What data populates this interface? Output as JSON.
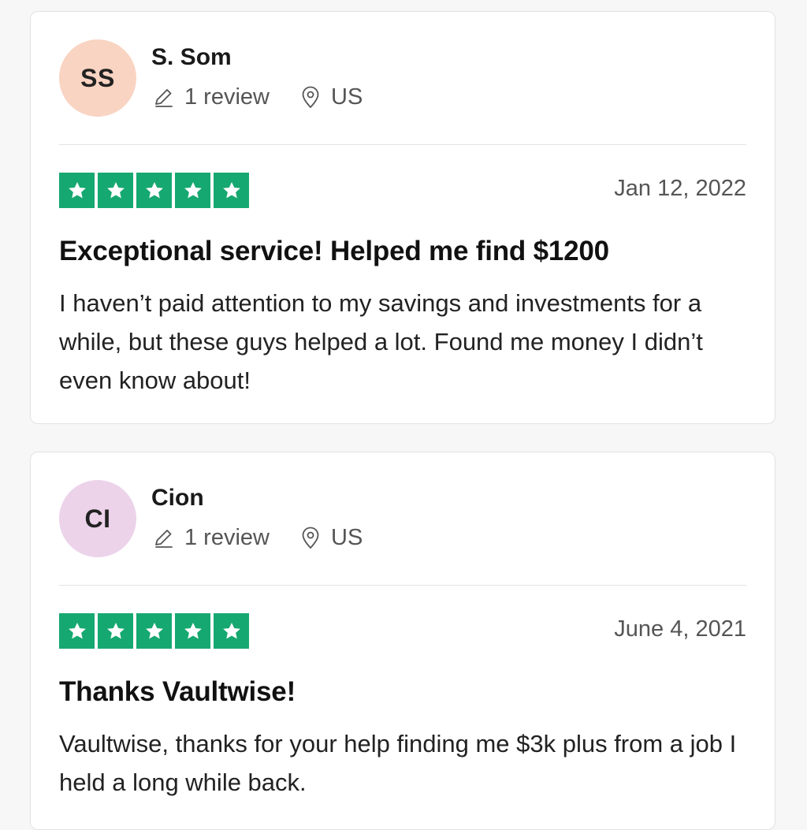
{
  "reviews": [
    {
      "initials": "SS",
      "avatar_color": "#f9d4c2",
      "name": "S. Som",
      "review_count": "1 review",
      "location": "US",
      "rating": 5,
      "date": "Jan 12, 2022",
      "title": "Exceptional service! Helped me find $1200",
      "body": "I haven’t paid attention to my savings and investments for a while, but these guys helped a lot. Found me money I didn’t even know about!"
    },
    {
      "initials": "CI",
      "avatar_color": "#ecd3ea",
      "name": "Cion",
      "review_count": "1 review",
      "location": "US",
      "rating": 5,
      "date": "June 4, 2021",
      "title": "Thanks Vaultwise!",
      "body": "Vaultwise, thanks for your help finding me $3k plus from a job I held a long while back."
    }
  ],
  "colors": {
    "star_green": "#16a871",
    "page_bg": "#f7f7f7"
  },
  "icons": {
    "review_count": "pencil-icon",
    "location": "map-pin-icon",
    "rating": "star-icon"
  }
}
